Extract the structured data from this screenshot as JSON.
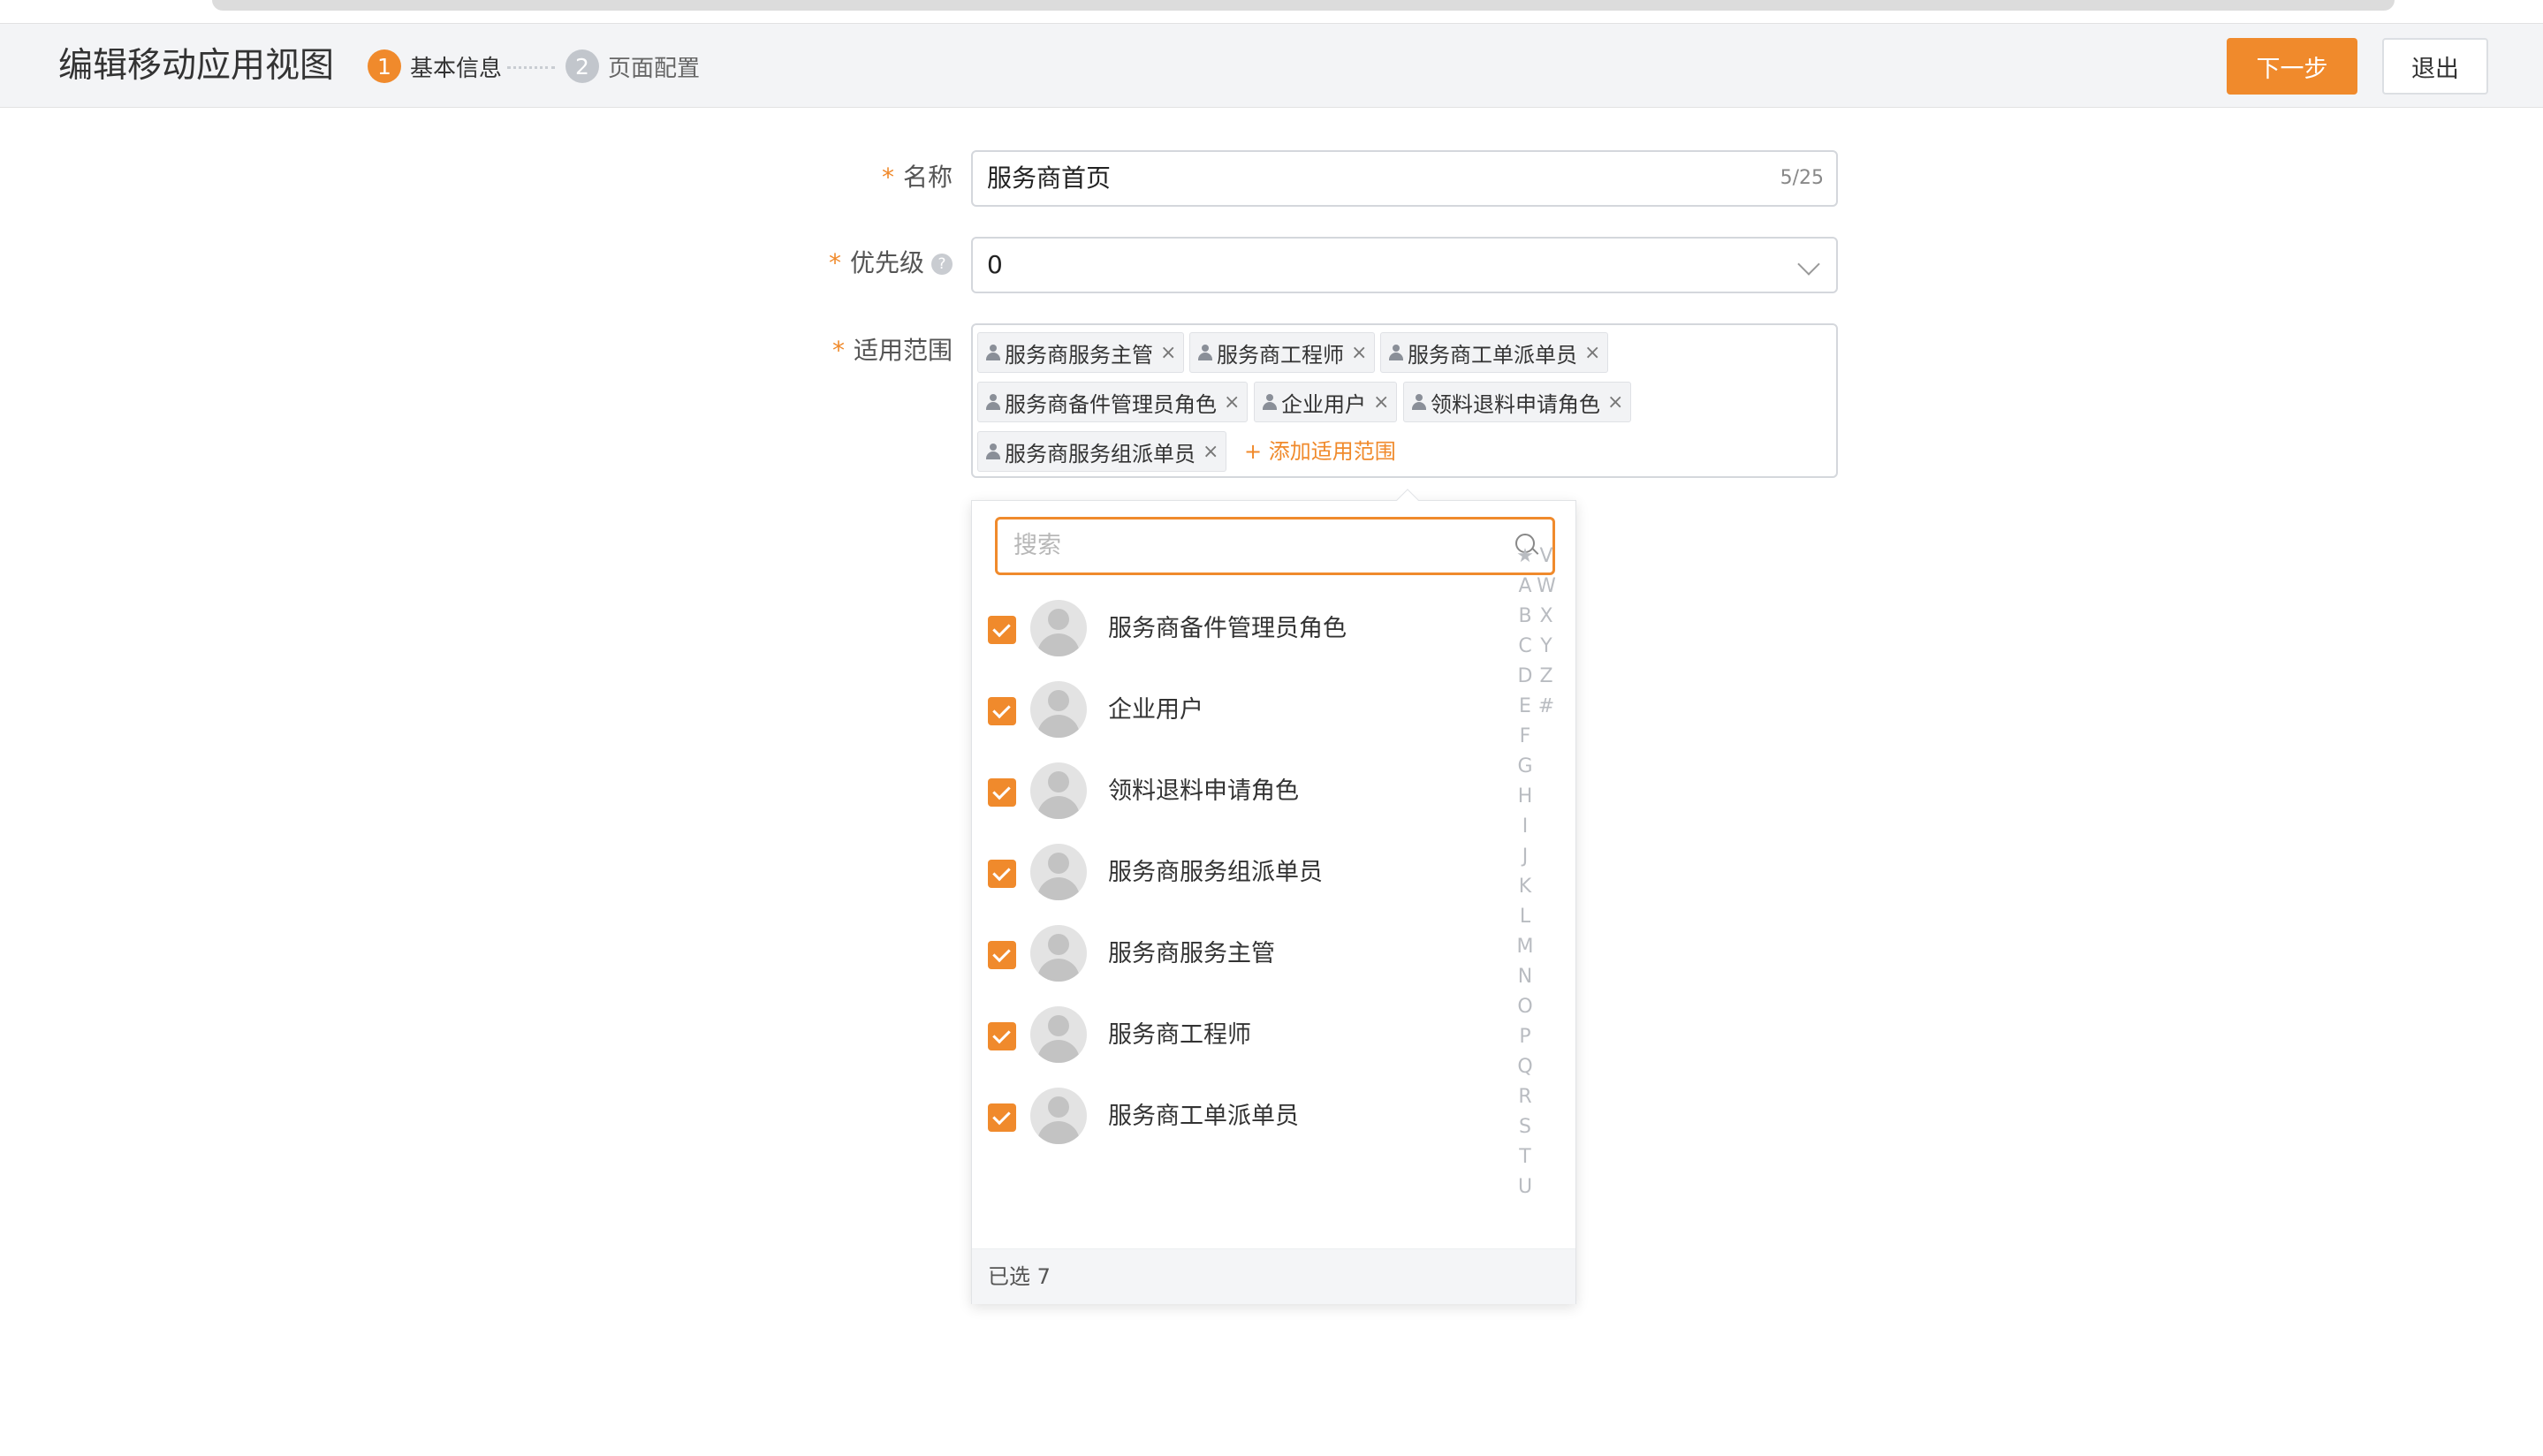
{
  "header": {
    "title": "编辑移动应用视图",
    "steps": [
      {
        "num": "1",
        "label": "基本信息",
        "active": true
      },
      {
        "num": "2",
        "label": "页面配置",
        "active": false
      }
    ],
    "next_button": "下一步",
    "exit_button": "退出"
  },
  "form": {
    "name": {
      "required_mark": "*",
      "label": "名称",
      "value": "服务商首页",
      "counter": "5/25"
    },
    "priority": {
      "required_mark": "*",
      "label": "优先级",
      "help_icon": "?",
      "value": "0"
    },
    "scope": {
      "required_mark": "*",
      "label": "适用范围",
      "tags": [
        {
          "label": "服务商服务主管",
          "remove": "×"
        },
        {
          "label": "服务商工程师",
          "remove": "×"
        },
        {
          "label": "服务商工单派单员",
          "remove": "×"
        },
        {
          "label": "服务商备件管理员角色",
          "remove": "×"
        },
        {
          "label": "企业用户",
          "remove": "×"
        },
        {
          "label": "领料退料申请角色",
          "remove": "×"
        },
        {
          "label": "服务商服务组派单员",
          "remove": "×"
        }
      ],
      "add_link": "+ 添加适用范围"
    }
  },
  "dropdown": {
    "search_placeholder": "搜索",
    "items": [
      {
        "name": "服务商备件管理员角色",
        "checked": true
      },
      {
        "name": "企业用户",
        "checked": true
      },
      {
        "name": "领料退料申请角色",
        "checked": true
      },
      {
        "name": "服务商服务组派单员",
        "checked": true
      },
      {
        "name": "服务商服务主管",
        "checked": true
      },
      {
        "name": "服务商工程师",
        "checked": true
      },
      {
        "name": "服务商工单派单员",
        "checked": true
      }
    ],
    "index_col1": [
      "★",
      "A",
      "B",
      "C",
      "D",
      "E",
      "F",
      "G",
      "H",
      "I",
      "J",
      "K",
      "L",
      "M",
      "N",
      "O",
      "P",
      "Q",
      "R",
      "S",
      "T",
      "U"
    ],
    "index_col2": [
      "V",
      "W",
      "X",
      "Y",
      "Z",
      "#"
    ],
    "selected_count": "已选 7"
  },
  "colors": {
    "accent": "#f08a2c",
    "border": "#d4d7dc",
    "header_bg": "#f3f4f6"
  }
}
